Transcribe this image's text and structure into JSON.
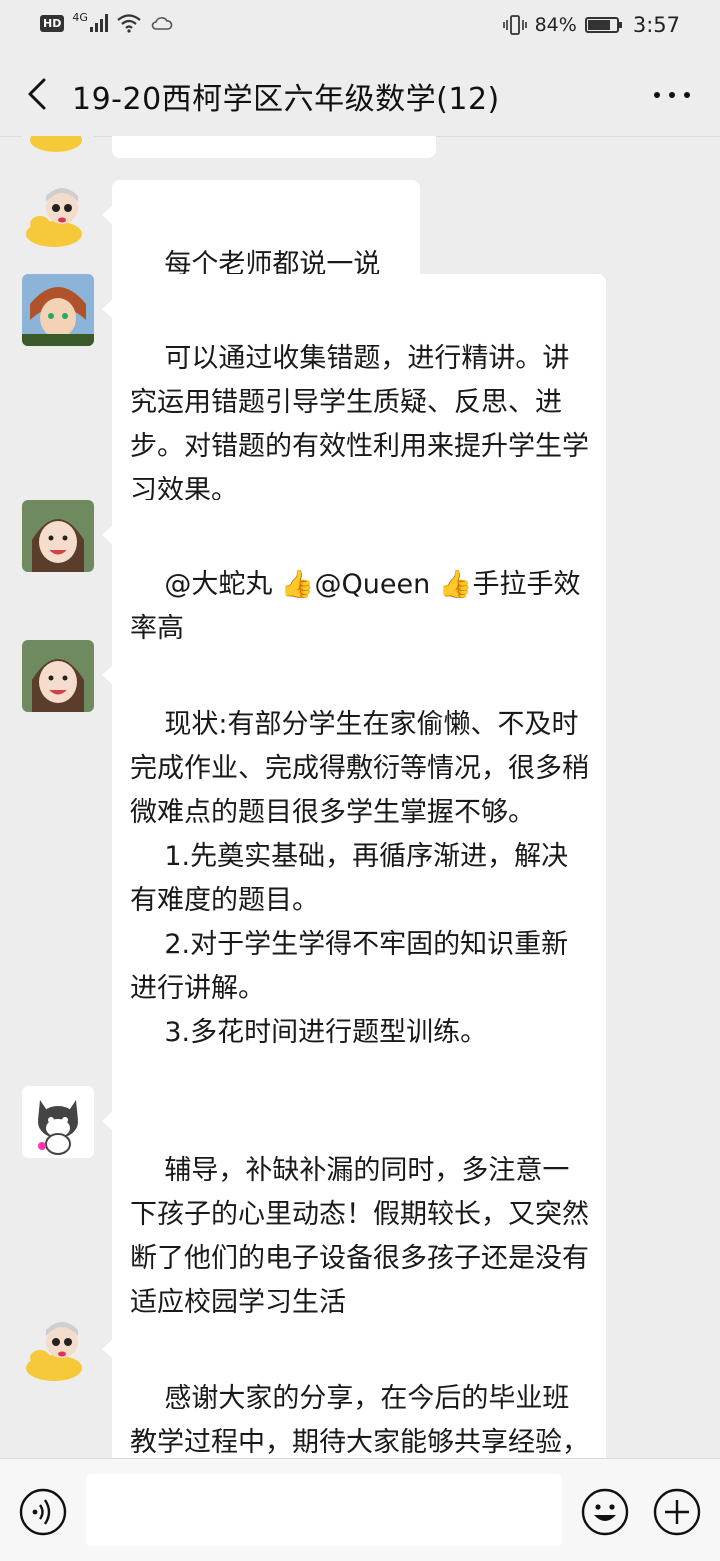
{
  "status_bar": {
    "network": "4G",
    "battery": "84%",
    "battery_level": 0.84,
    "time": "3:57"
  },
  "header": {
    "title": "19-20西柯学区六年级数学(12)"
  },
  "messages": [
    {
      "avatar": "duck-avatar",
      "text": ""
    },
    {
      "avatar": "duck-avatar",
      "text": "每个老师都说一说哈"
    },
    {
      "avatar": "anime-avatar",
      "text": "可以通过收集错题，进行精讲。讲究运用错题引导学生质疑、反思、进步。对错题的有效性利用来提升学生学习效果。"
    },
    {
      "avatar": "child-avatar",
      "text": "@大蛇丸 👍@Queen 👍手拉手效率高"
    },
    {
      "avatar": "child-avatar",
      "text": "现状:有部分学生在家偷懒、不及时完成作业、完成得敷衍等情况，很多稍微难点的题目很多学生掌握不够。\n    1.先奠实基础，再循序渐进，解决有难度的题目。\n    2.对于学生学得不牢固的知识重新进行讲解。\n    3.多花时间进行题型训练。"
    },
    {
      "avatar": "cat-avatar",
      "text": "辅导，补缺补漏的同时，多注意一下孩子的心里动态！假期较长，又突然断了他们的电子设备很多孩子还是没有适应校园学习生活"
    },
    {
      "avatar": "duck-avatar",
      "text": "感谢大家的分享，在今后的毕业班教学过程中，期待大家能够共享经验，互相学习。那么，本次的线上"
    }
  ],
  "icons": {
    "back": "back-arrow-icon",
    "more": "more-icon",
    "voice": "voice-icon",
    "emoji": "emoji-icon",
    "plus": "plus-icon"
  }
}
